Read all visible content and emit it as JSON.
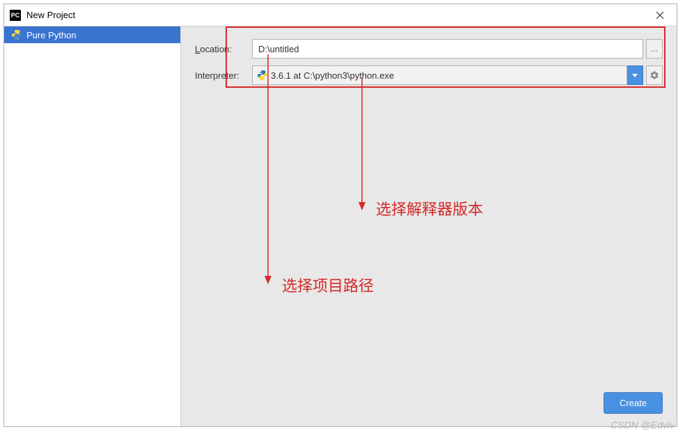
{
  "window": {
    "title": "New Project",
    "icon_label": "PC"
  },
  "sidebar": {
    "items": [
      {
        "label": "Pure Python"
      }
    ]
  },
  "form": {
    "location_label": "Location:",
    "location_access_key": "L",
    "location_rest": "ocation:",
    "location_value": "D:\\untitled",
    "browse_label": "...",
    "interpreter_label": "Interpreter:",
    "interpreter_value": "3.6.1 at C:\\python3\\python.exe"
  },
  "buttons": {
    "create": "Create"
  },
  "annotations": {
    "interpreter_note": "选择解释器版本",
    "path_note": "选择项目路径"
  },
  "watermark": "CSDN @Edviv",
  "colors": {
    "accent": "#3874d0",
    "button_blue": "#4a90e2",
    "annotation_red": "#d62828"
  }
}
